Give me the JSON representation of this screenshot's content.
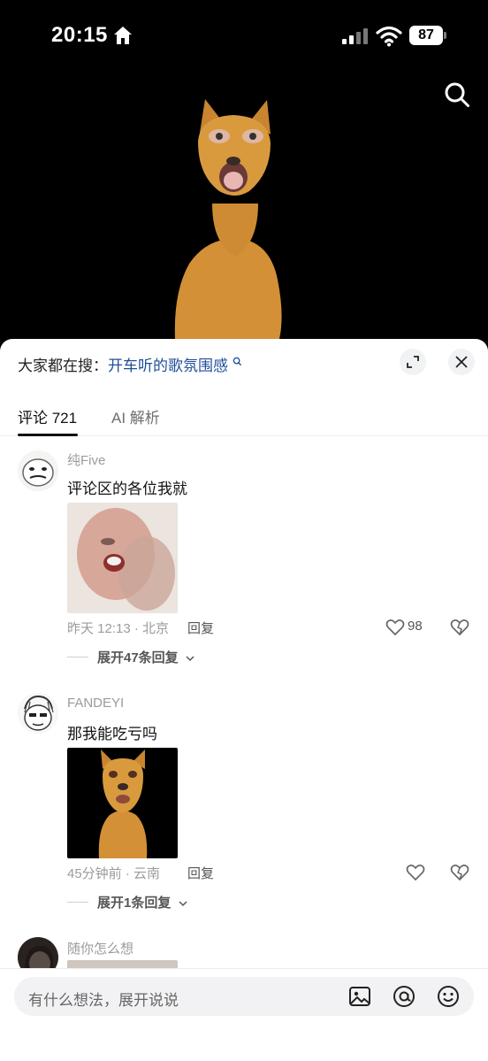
{
  "status_bar": {
    "time": "20:15",
    "battery": "87"
  },
  "sheet": {
    "trending_prefix": "大家都在搜：",
    "trending_term": "开车听的歌氛围感"
  },
  "tabs": [
    {
      "label": "评论 721",
      "active": true
    },
    {
      "label": "AI 解析",
      "active": false
    }
  ],
  "comments": [
    {
      "username": "纯Five",
      "text": "评论区的各位我就",
      "time_location": "昨天 12:13 · 北京",
      "reply_label": "回复",
      "likes": "98",
      "expand_replies": "展开47条回复"
    },
    {
      "username": "FANDEYI",
      "text": "那我能吃亏吗",
      "time_location": "45分钟前 · 云南",
      "reply_label": "回复",
      "likes": "",
      "expand_replies": "展开1条回复"
    },
    {
      "username": "随你怎么想"
    }
  ],
  "composer": {
    "placeholder": "有什么想法，展开说说"
  },
  "colors": {
    "link_blue": "#1f4f9a",
    "dog_orange": "#d9962e"
  }
}
